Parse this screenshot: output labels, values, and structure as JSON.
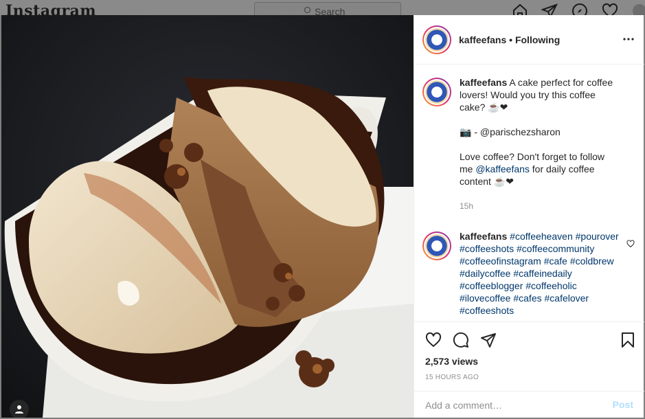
{
  "background": {
    "logo": "Instagram",
    "search_placeholder": "Search",
    "nav_icons": [
      "home-icon",
      "direct-icon",
      "explore-icon",
      "activity-icon",
      "profile-avatar"
    ]
  },
  "post": {
    "header": {
      "username": "kaffeefans",
      "separator": "•",
      "follow_status": "Following",
      "more_icon": "more-options-icon"
    },
    "caption": {
      "username": "kaffeefans",
      "line1": "A cake perfect for coffee lovers! Would you try this coffee cake? ☕❤",
      "credit_icon": "📷",
      "credit_text": " - @parischezsharon",
      "promo_before": "Love coffee? Don't forget to follow me ",
      "promo_mention": "@kaffeefans",
      "promo_after": " for daily coffee content ☕❤",
      "time": "15h"
    },
    "hashtag_comment": {
      "username": "kaffeefans",
      "tags": "#coffeeheaven #pourover #coffeeshots #coffeecommunity #coffeeofinstagram #cafe #coldbrew #dailycoffee #caffeinedaily #coffeeblogger #coffeeholic #ilovecoffee #cafes #cafelover #coffeeshots",
      "like_icon": "heart-outline-icon"
    },
    "actions": {
      "icons": [
        "like-icon",
        "comment-icon",
        "share-icon"
      ],
      "save_icon": "bookmark-icon",
      "views": "2,573 views",
      "posted": "15 HOURS AGO"
    },
    "comment_box": {
      "placeholder": "Add a comment…",
      "post_label": "Post"
    }
  },
  "colors": {
    "link": "#00376b",
    "muted": "#8e8e8e",
    "post_disabled": "#b2dffc"
  }
}
